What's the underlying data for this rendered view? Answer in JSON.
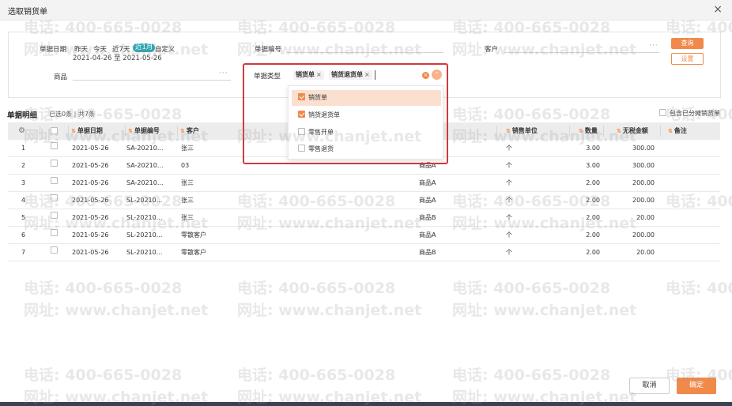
{
  "dialog": {
    "title": "选取销货单",
    "close_glyph": "×"
  },
  "filters": {
    "date_label": "单据日期",
    "date_options": [
      "昨天",
      "今天",
      "近7天",
      "近1月",
      "自定义"
    ],
    "date_selected": "近1月",
    "date_range": "2021-04-26 至 2021-05-26",
    "doc_no_label": "单据编号",
    "customer_label": "客户",
    "product_label": "商品",
    "doc_type_label": "单据类型",
    "doc_type_tags": [
      "销货单",
      "销货退货单"
    ],
    "query_button": "查询",
    "settings_button": "设置"
  },
  "doc_type_dropdown": [
    {
      "label": "销货单",
      "checked": true,
      "highlighted": true
    },
    {
      "label": "销货退货单",
      "checked": true,
      "highlighted": false
    },
    {
      "label": "零售开单",
      "checked": false,
      "highlighted": false
    },
    {
      "label": "零售退货",
      "checked": false,
      "highlighted": false
    }
  ],
  "details": {
    "title": "单据明细",
    "selected_text": "已选0条",
    "total_text": "共7条",
    "include_allocated_label": "包含已分摊销货单"
  },
  "table": {
    "headers": [
      "单据日期",
      "单据编号",
      "客户",
      "销售单位",
      "数量",
      "无税金额",
      "备注"
    ],
    "rows": [
      {
        "no": "1",
        "date": "2021-05-26",
        "doc_no": "SA-20210...",
        "customer": "张三",
        "product": "",
        "unit": "个",
        "qty": "3.00",
        "amount": "300.00"
      },
      {
        "no": "2",
        "date": "2021-05-26",
        "doc_no": "SA-20210...",
        "customer": "03",
        "product": "商品A",
        "unit": "个",
        "qty": "3.00",
        "amount": "300.00"
      },
      {
        "no": "3",
        "date": "2021-05-26",
        "doc_no": "SA-20210...",
        "customer": "张三",
        "product": "商品A",
        "unit": "个",
        "qty": "2.00",
        "amount": "200.00"
      },
      {
        "no": "4",
        "date": "2021-05-26",
        "doc_no": "SL-20210...",
        "customer": "张三",
        "product": "商品A",
        "unit": "个",
        "qty": "2.00",
        "amount": "200.00"
      },
      {
        "no": "5",
        "date": "2021-05-26",
        "doc_no": "SL-20210...",
        "customer": "张三",
        "product": "商品B",
        "unit": "个",
        "qty": "2.00",
        "amount": "20.00"
      },
      {
        "no": "6",
        "date": "2021-05-26",
        "doc_no": "SL-20210...",
        "customer": "零散客户",
        "product": "商品A",
        "unit": "个",
        "qty": "2.00",
        "amount": "200.00"
      },
      {
        "no": "7",
        "date": "2021-05-26",
        "doc_no": "SL-20210...",
        "customer": "零散客户",
        "product": "商品B",
        "unit": "个",
        "qty": "2.00",
        "amount": "20.00"
      }
    ]
  },
  "footer": {
    "cancel_button": "取消",
    "ok_button": "确定"
  },
  "watermark": {
    "phone": "电话: 400-665-0028",
    "site": "网址: www.chanjet.net"
  },
  "icons": {
    "settings": "gear-icon",
    "clear": "clear-icon",
    "collapse": "chevron-up-icon"
  },
  "colors": {
    "accent": "#f08a4b",
    "date_active": "#2aa7b8",
    "highlight_border": "#d33a3a"
  }
}
